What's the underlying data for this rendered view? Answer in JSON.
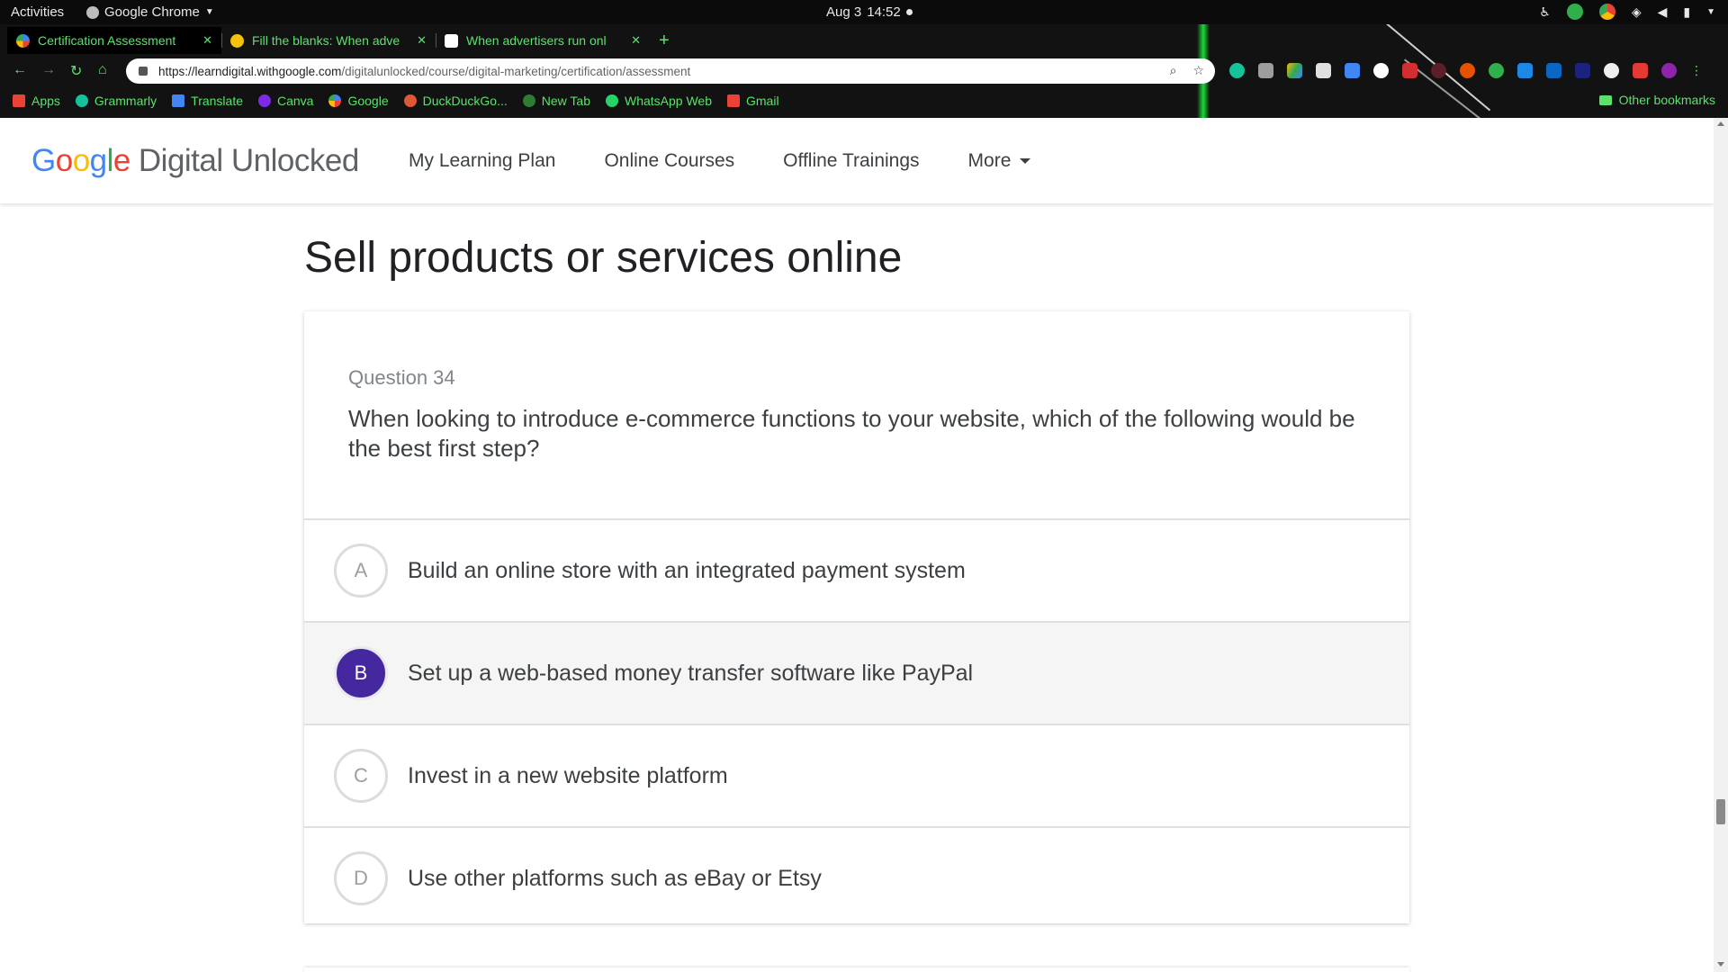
{
  "system_bar": {
    "activities": "Activities",
    "app_name": "Google Chrome",
    "date": "Aug 3",
    "time": "14:52"
  },
  "browser": {
    "tabs": [
      {
        "title": "Certification Assessment",
        "favicon_color": "#ffffff",
        "active": true
      },
      {
        "title": "Fill the blanks: When adve",
        "favicon_color": "#f4c20d",
        "active": false
      },
      {
        "title": "When advertisers run onl",
        "favicon_color": "#ffffff",
        "active": false
      }
    ],
    "url_host": "https://learndigital.withgoogle.com",
    "url_path": "/digitalunlocked/course/digital-marketing/certification/assessment",
    "bookmarks": [
      {
        "label": "Apps",
        "icon": "apps-grid-icon",
        "color": "#ea4335"
      },
      {
        "label": "Grammarly",
        "icon": "grammarly-icon",
        "color": "#15c39a"
      },
      {
        "label": "Translate",
        "icon": "translate-icon",
        "color": "#4285f4"
      },
      {
        "label": "Canva",
        "icon": "canva-icon",
        "color": "#7d2ae8"
      },
      {
        "label": "Google",
        "icon": "google-icon",
        "color": "#ffffff"
      },
      {
        "label": "DuckDuckGo...",
        "icon": "duckduckgo-icon",
        "color": "#de5833"
      },
      {
        "label": "New Tab",
        "icon": "new-tab-icon",
        "color": "#2e7d32"
      },
      {
        "label": "WhatsApp Web",
        "icon": "whatsapp-icon",
        "color": "#25d366"
      },
      {
        "label": "Gmail",
        "icon": "gmail-icon",
        "color": "#ea4335"
      }
    ],
    "other_bookmarks": "Other bookmarks",
    "accent_color": "#59e36b"
  },
  "site": {
    "logo_word": "Google",
    "product_name": "Digital Unlocked",
    "nav": [
      "My Learning Plan",
      "Online Courses",
      "Offline Trainings",
      "More"
    ]
  },
  "main": {
    "section_title": "Sell products or services online",
    "question_number": "Question 34",
    "question_text": "When looking to introduce e-commerce functions to your website, which of the following would be the best first step?",
    "options": [
      {
        "letter": "A",
        "text": "Build an online store with an integrated payment system",
        "selected": false
      },
      {
        "letter": "B",
        "text": "Set up a web-based money transfer software like PayPal",
        "selected": true
      },
      {
        "letter": "C",
        "text": "Invest in a new website platform",
        "selected": false
      },
      {
        "letter": "D",
        "text": "Use other platforms such as eBay or Etsy",
        "selected": false
      }
    ],
    "selected_color": "#4527a0"
  }
}
